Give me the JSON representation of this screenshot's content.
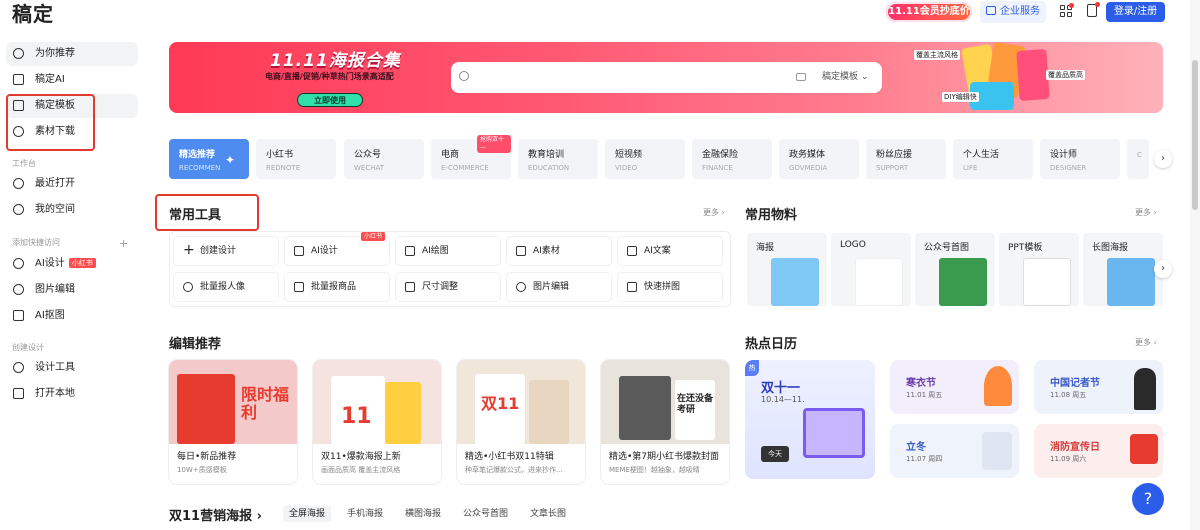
{
  "header": {
    "logo": "稿定",
    "promo": "11.11会员抄底价",
    "enterprise": "企业服务",
    "login": "登录/注册"
  },
  "sidebar": {
    "items": [
      {
        "label": "为你推荐",
        "icon": "compass-icon"
      },
      {
        "label": "稿定AI",
        "icon": "ai-scan-icon"
      },
      {
        "label": "稿定模板",
        "icon": "template-icon"
      },
      {
        "label": "素材下载",
        "icon": "material-icon"
      }
    ],
    "workspace_title": "工作台",
    "workspace": [
      {
        "label": "最近打开",
        "icon": "clock-icon"
      },
      {
        "label": "我的空间",
        "icon": "user-icon"
      }
    ],
    "quick_title": "添加快捷访问",
    "quick": [
      {
        "label": "AI设计",
        "tag": "小红书",
        "icon": "infinity-icon"
      },
      {
        "label": "图片编辑",
        "icon": "palette-icon"
      },
      {
        "label": "AI抠图",
        "icon": "cutout-icon"
      }
    ],
    "create_title": "创建设计",
    "create": [
      {
        "label": "设计工具",
        "icon": "pen-icon"
      },
      {
        "label": "打开本地",
        "icon": "folder-icon"
      }
    ]
  },
  "banner": {
    "title": "11.11海报合集",
    "subtitle": "电商/直播/促销/种草热门场景高适配",
    "use_button": "立即使用",
    "search_scope": "稿定模板",
    "deco": [
      "覆盖主流风格",
      "覆盖品质高",
      "DIY编辑快"
    ]
  },
  "categories": [
    {
      "cn": "精选推荐",
      "en": "RECOMMEN"
    },
    {
      "cn": "小红书",
      "en": "REDNOTE"
    },
    {
      "cn": "公众号",
      "en": "WECHAT"
    },
    {
      "cn": "电商",
      "en": "E-COMMERCE",
      "hot": "抢购双十一"
    },
    {
      "cn": "教育培训",
      "en": "EDUCATION"
    },
    {
      "cn": "短视频",
      "en": "VIDEO"
    },
    {
      "cn": "金融保险",
      "en": "FINANCE"
    },
    {
      "cn": "政务媒体",
      "en": "GOVMEDIA"
    },
    {
      "cn": "粉丝应援",
      "en": "SUPPORT"
    },
    {
      "cn": "个人生活",
      "en": "LIFE"
    },
    {
      "cn": "设计师",
      "en": "DESIGNER"
    },
    {
      "cn": "",
      "en": "C"
    }
  ],
  "tools": {
    "title": "常用工具",
    "more": "更多 ›",
    "items": [
      {
        "label": "创建设计"
      },
      {
        "label": "AI设计",
        "tag": "小红书"
      },
      {
        "label": "AI绘图"
      },
      {
        "label": "AI素材"
      },
      {
        "label": "AI文案"
      },
      {
        "label": "批量报人像"
      },
      {
        "label": "批量报商品"
      },
      {
        "label": "尺寸调整"
      },
      {
        "label": "图片编辑"
      },
      {
        "label": "快速拼图"
      }
    ]
  },
  "materials": {
    "title": "常用物料",
    "more": "更多 ›",
    "items": [
      {
        "label": "海报",
        "color": "#7fc8f5"
      },
      {
        "label": "LOGO",
        "color": "#ffffff"
      },
      {
        "label": "公众号首图",
        "color": "#3a9a4e"
      },
      {
        "label": "PPT模板",
        "color": "#f0f0f0"
      },
      {
        "label": "长图海报",
        "color": "#6ab7f0"
      }
    ]
  },
  "editor": {
    "title": "编辑推荐",
    "items": [
      {
        "title": "每日•新品推荐",
        "sub": "10W+质感模板",
        "img": "#f4c9c9",
        "word": "限时福利"
      },
      {
        "title": "双11•爆款海报上新",
        "sub": "画面品质高 覆盖主流风格",
        "img": "#f5e3df",
        "word": "11"
      },
      {
        "title": "精选•小红书双11特辑",
        "sub": "种草笔记爆款公式，进来抄作...",
        "img": "#f0e6da",
        "word": "双11"
      },
      {
        "title": "精选•第7期小红书爆款封面",
        "sub": "MEME梗图！越抽象，越吸睛",
        "img": "#e8e4dc",
        "word": "在还没备考研"
      }
    ]
  },
  "hot": {
    "title": "热点日历",
    "more": "更多 ›",
    "flag": "热",
    "main": {
      "name": "双十一",
      "date": "10.14—11.",
      "today": "今天"
    },
    "cards": [
      {
        "name": "寒衣节",
        "date": "11.01 周五",
        "color": "#6a3ea8",
        "bg": "#f3eefb"
      },
      {
        "name": "中国记者节",
        "date": "11.08 周五",
        "color": "#3a5bc8",
        "bg": "#eef2fb"
      },
      {
        "name": "立冬",
        "date": "11.07 周四",
        "color": "#3a5bc8",
        "bg": "#eef3fc"
      },
      {
        "name": "消防宣传日",
        "date": "11.09 周六",
        "color": "#d83a3a",
        "bg": "#fdeeee"
      }
    ]
  },
  "bottom": {
    "title": "双11营销海报",
    "tabs": [
      "全屏海报",
      "手机海报",
      "横图海报",
      "公众号首图",
      "文章长图"
    ]
  },
  "help": "?"
}
